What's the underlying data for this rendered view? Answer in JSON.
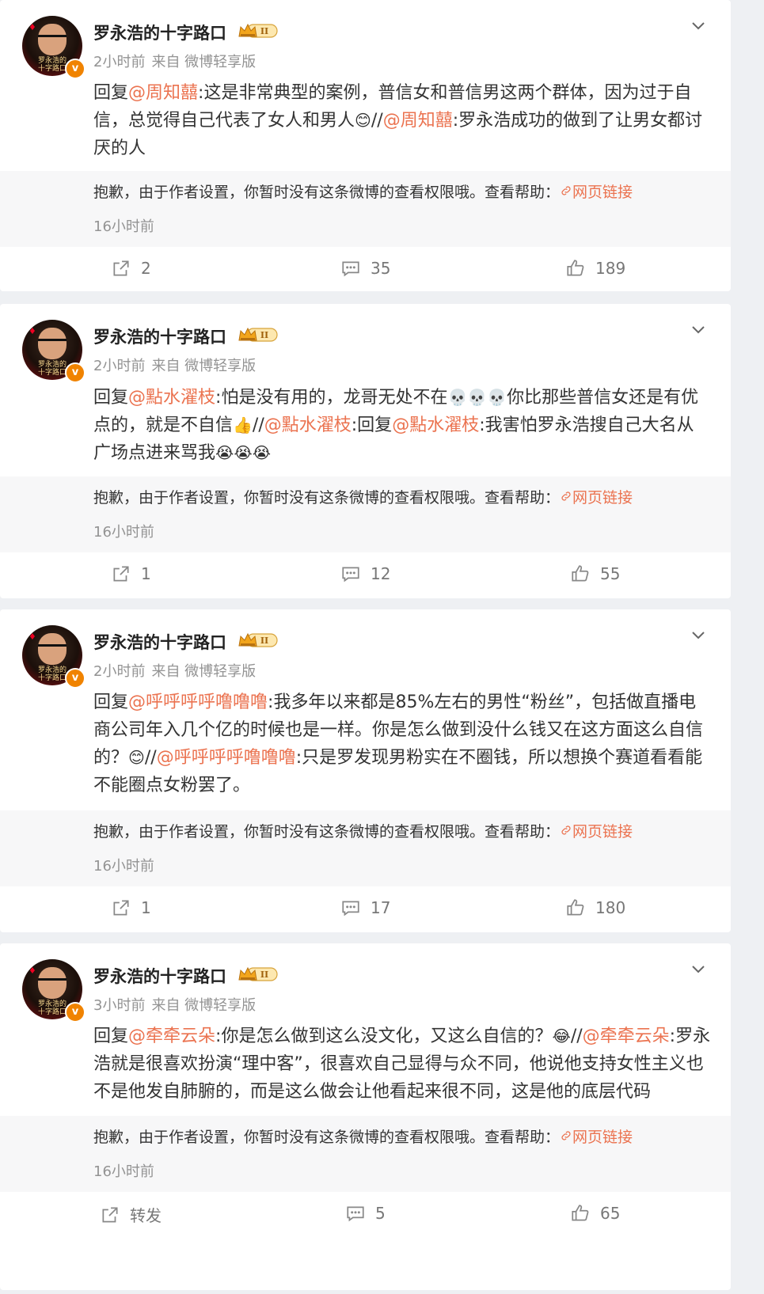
{
  "notice_text": "抱歉，由于作者设置，你暂时没有这条微博的查看权限哦。查看帮助：",
  "notice_link": "网页链接",
  "posts": [
    {
      "username": "罗永浩的十字路口",
      "time": "2小时前",
      "source": "来自 微博轻享版",
      "text": [
        {
          "t": "回复"
        },
        {
          "t": "@周知囍",
          "link": true
        },
        {
          "t": ":这是非常典型的案例，普信女和普信男这两个群体，因为过于自信，总觉得自己代表了女人和男人"
        },
        {
          "t": "😊",
          "emoji": true
        },
        {
          "t": "//"
        },
        {
          "t": "@周知囍",
          "link": true
        },
        {
          "t": ":罗永浩成功的做到了让男女都讨厌的人"
        }
      ],
      "notice_time": "16小时前",
      "repost": "2",
      "comments": "35",
      "likes": "189"
    },
    {
      "username": "罗永浩的十字路口",
      "time": "2小时前",
      "source": "来自 微博轻享版",
      "text": [
        {
          "t": "回复"
        },
        {
          "t": "@點水濯枝",
          "link": true
        },
        {
          "t": ":怕是没有用的，龙哥无处不在"
        },
        {
          "t": "💀💀💀",
          "emoji": true
        },
        {
          "t": "你比那些普信女还是有优点的，就是不自信"
        },
        {
          "t": "👍",
          "emoji": true
        },
        {
          "t": "//"
        },
        {
          "t": "@點水濯枝",
          "link": true
        },
        {
          "t": ":回复"
        },
        {
          "t": "@點水濯枝",
          "link": true
        },
        {
          "t": ":我害怕罗永浩搜自己大名从广场点进来骂我"
        },
        {
          "t": "😭😭😭",
          "emoji": true
        }
      ],
      "notice_time": "16小时前",
      "repost": "1",
      "comments": "12",
      "likes": "55"
    },
    {
      "username": "罗永浩的十字路口",
      "time": "2小时前",
      "source": "来自 微博轻享版",
      "text": [
        {
          "t": "回复"
        },
        {
          "t": "@呼呼呼呼噜噜噜",
          "link": true
        },
        {
          "t": ":￼我多年以来都是85%左右的男性“粉丝”，包括做直播电商公司年入几个亿￼的时候也是一样。￼你是怎么做到没什么钱又在这方面这么自信的？"
        },
        {
          "t": "😊",
          "emoji": true
        },
        {
          "t": "￼//"
        },
        {
          "t": "@呼呼呼呼噜噜噜",
          "link": true
        },
        {
          "t": ":只是罗发现男粉实在不圈钱，所以想换个赛道看看能不能圈点女粉罢了。"
        }
      ],
      "notice_time": "16小时前",
      "repost": "1",
      "comments": "17",
      "likes": "180"
    },
    {
      "username": "罗永浩的十字路口",
      "time": "3小时前",
      "source": "来自 微博轻享版",
      "text": [
        {
          "t": "回复"
        },
        {
          "t": "@牵牵云朵",
          "link": true
        },
        {
          "t": ":你是怎么做到这么没文化，又这么自信的？"
        },
        {
          "t": "😂",
          "emoji": true
        },
        {
          "t": "//"
        },
        {
          "t": "@牵牵云朵",
          "link": true
        },
        {
          "t": ":罗永浩就是很喜欢扮演“理中客”，很喜欢自己显得与众不同，他说他支持女性主义也不是他发自肺腑的，而是这么做会让他看起来很不同，这是他的底层代码"
        }
      ],
      "notice_time": "16小时前",
      "repost": "转发",
      "comments": "5",
      "likes": "65"
    }
  ],
  "avatar_caption": "罗永浩的十字路口",
  "icons": {
    "repost": "share-icon",
    "comment": "comment-icon",
    "like": "thumbs-up-icon",
    "expand": "chevron-down-icon",
    "link": "link-icon"
  },
  "colors": {
    "link": "#eb7350",
    "meta": "#939393",
    "vip": "#f08300"
  }
}
